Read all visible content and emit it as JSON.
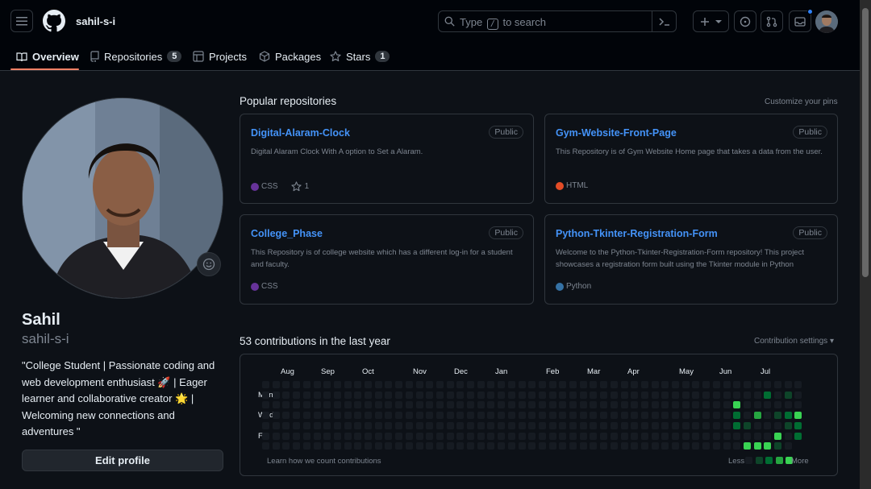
{
  "header": {
    "username": "sahil-s-i",
    "search": {
      "prefix": "Type",
      "key": "/",
      "suffix": "to search"
    }
  },
  "tabs": [
    {
      "label": "Overview",
      "count": null
    },
    {
      "label": "Repositories",
      "count": "5"
    },
    {
      "label": "Projects",
      "count": null
    },
    {
      "label": "Packages",
      "count": null
    },
    {
      "label": "Stars",
      "count": "1"
    }
  ],
  "profile": {
    "name": "Sahil",
    "login": "sahil-s-i",
    "bio": "\"College Student | Passionate coding and web development enthusiast 🚀 | Eager learner and collaborative creator 🌟 | Welcoming new connections and adventures \"",
    "edit_label": "Edit profile"
  },
  "popular": {
    "title": "Popular repositories",
    "customize": "Customize your pins",
    "repos": [
      {
        "name": "Digital-Alaram-Clock",
        "visibility": "Public",
        "description": "Digital Alaram Clock With A option to Set a Alaram.",
        "language": "CSS",
        "lang_color": "#663399",
        "stars": "1"
      },
      {
        "name": "Gym-Website-Front-Page",
        "visibility": "Public",
        "description": "This Repository is of Gym Website Home page that takes a data from the user.",
        "language": "HTML",
        "lang_color": "#e34c26",
        "stars": null
      },
      {
        "name": "College_Phase",
        "visibility": "Public",
        "description": "This Repository is of college website which has a different log-in for a student and faculty.",
        "language": "CSS",
        "lang_color": "#663399",
        "stars": null
      },
      {
        "name": "Python-Tkinter-Registration-Form",
        "visibility": "Public",
        "description": "Welcome to the Python-Tkinter-Registration-Form repository! This project showcases a registration form built using the Tkinter module in Python",
        "language": "Python",
        "lang_color": "#3572A5",
        "stars": null
      }
    ]
  },
  "contributions": {
    "title": "53 contributions in the last year",
    "settings": "Contribution settings ▾",
    "months": [
      "Aug",
      "Sep",
      "Oct",
      "Nov",
      "Dec",
      "Jan",
      "Feb",
      "Mar",
      "Apr",
      "May",
      "Jun",
      "Jul"
    ],
    "days": [
      "Mon",
      "Wed",
      "Fri"
    ],
    "learn": "Learn how we count contributions",
    "less": "Less",
    "more": "More",
    "colors": [
      "#161b22",
      "#0e4429",
      "#006d32",
      "#26a641",
      "#39d353"
    ]
  }
}
